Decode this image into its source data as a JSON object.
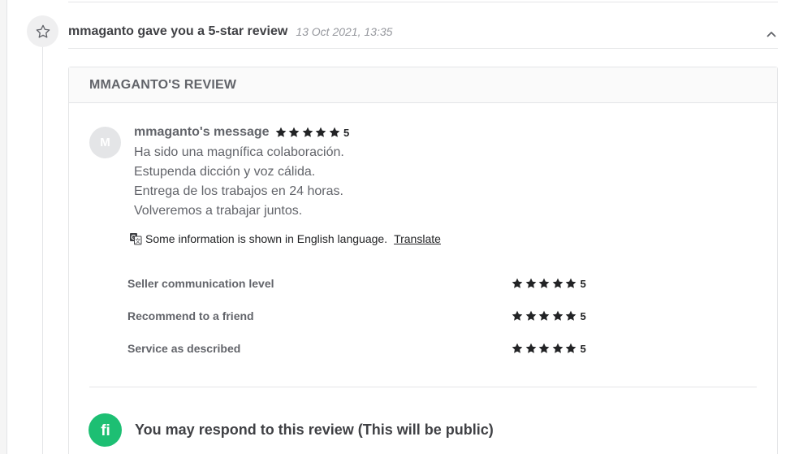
{
  "event": {
    "icon": "star-outline-icon",
    "title": "mmaganto gave you a 5-star review",
    "timestamp": "13 Oct 2021, 13:35",
    "toggle_icon": "chevron-up-icon"
  },
  "review": {
    "title": "MMAGANTO'S REVIEW",
    "avatar_initial": "M",
    "author_label": "mmaganto's message",
    "overall_rating": "5",
    "message_lines": [
      "Ha sido una magnífica colaboración.",
      "Estupenda dicción y voz cálida.",
      "Entrega de los trabajos en 24 horas.",
      "Volveremos a trabajar juntos."
    ],
    "translate_notice": "Some information is shown in English language.",
    "translate_link": "Translate",
    "criteria": [
      {
        "label": "Seller communication level",
        "rating": "5"
      },
      {
        "label": "Recommend to a friend",
        "rating": "5"
      },
      {
        "label": "Service as described",
        "rating": "5"
      }
    ]
  },
  "respond": {
    "logo_text": "fi",
    "text": "You may respond to this review (This will be public)"
  },
  "colors": {
    "brand_green": "#1dbf73",
    "star": "#222325",
    "text_muted": "#62646a"
  }
}
